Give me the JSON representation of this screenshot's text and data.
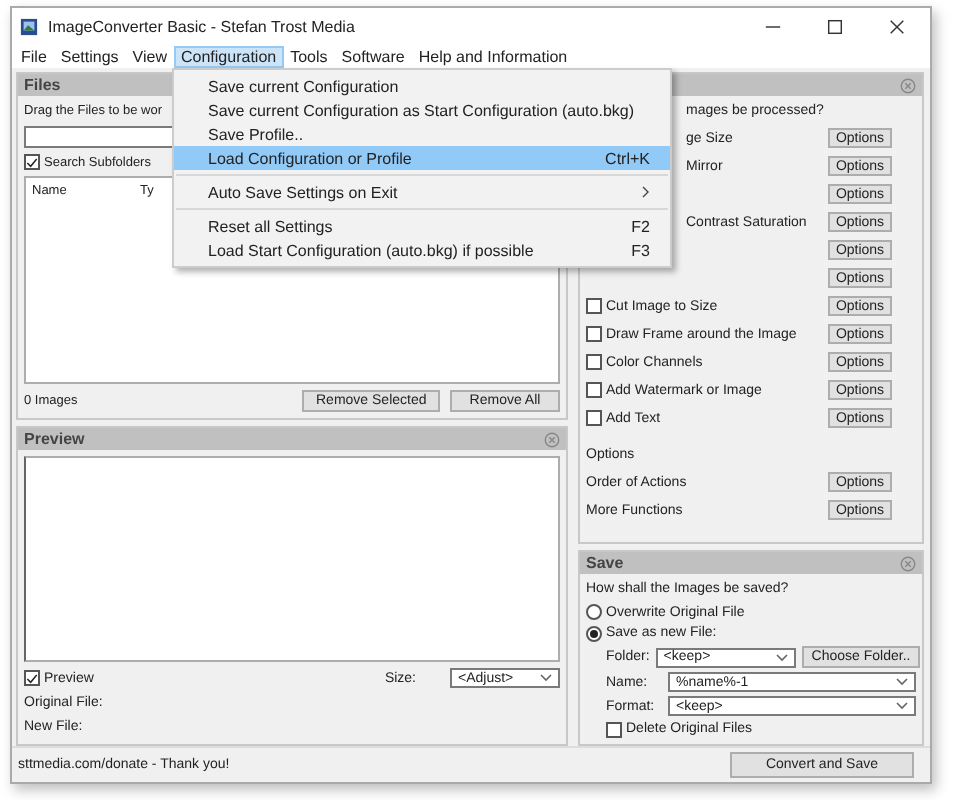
{
  "window": {
    "title": "ImageConverter Basic - Stefan Trost Media"
  },
  "menu_bar": [
    {
      "label": "File",
      "selected": false
    },
    {
      "label": "Settings",
      "selected": false
    },
    {
      "label": "View",
      "selected": false
    },
    {
      "label": "Configuration",
      "selected": true
    },
    {
      "label": "Tools",
      "selected": false
    },
    {
      "label": "Software",
      "selected": false
    },
    {
      "label": "Help and Information",
      "selected": false
    }
  ],
  "open_menu": {
    "items": [
      {
        "kind": "item",
        "label": "Save current Configuration",
        "selected": false
      },
      {
        "kind": "item",
        "label": "Save current Configuration as Start Configuration (auto.bkg)",
        "selected": false
      },
      {
        "kind": "item",
        "label": "Save Profile..",
        "selected": false
      },
      {
        "kind": "item",
        "label": "Load Configuration or Profile",
        "shortcut": "Ctrl+K",
        "selected": true
      },
      {
        "kind": "separator"
      },
      {
        "kind": "submenu",
        "label": "Auto Save Settings on Exit",
        "selected": false
      },
      {
        "kind": "separator"
      },
      {
        "kind": "item",
        "label": "Reset all Settings",
        "shortcut": "F2",
        "selected": false
      },
      {
        "kind": "item",
        "label": "Load Start Configuration (auto.bkg) if possible",
        "shortcut": "F3",
        "selected": false
      }
    ]
  },
  "files_panel": {
    "title": "Files",
    "hint": "Drag the Files to be wor",
    "search_subfolders": {
      "label": "Search Subfolders",
      "checked": true
    },
    "columns": [
      "Name",
      "Ty"
    ],
    "count": "0 Images",
    "buttons": [
      "Remove Selected",
      "Remove All"
    ]
  },
  "preview_panel": {
    "title": "Preview",
    "preview_checkbox": {
      "label": "Preview",
      "checked": true
    },
    "size_label": "Size:",
    "size_value": "<Adjust>",
    "original_file": "Original File:",
    "new_file": "New File:"
  },
  "actions_panel": {
    "question": "mages be processed?",
    "actions": [
      {
        "kind": "partial",
        "label": "ge Size",
        "button": "Options"
      },
      {
        "kind": "partial",
        "label": "Mirror",
        "button": "Options"
      },
      {
        "kind": "partial",
        "button": "Options"
      },
      {
        "kind": "partial",
        "label": "Contrast Saturation",
        "button": "Options"
      },
      {
        "kind": "partial",
        "button": "Options"
      },
      {
        "kind": "partial",
        "button": "Options"
      },
      {
        "kind": "checkbox",
        "label": "Cut Image to Size",
        "checked": false,
        "button": "Options"
      },
      {
        "kind": "checkbox",
        "label": "Draw Frame around the Image",
        "checked": false,
        "button": "Options"
      },
      {
        "kind": "checkbox",
        "label": "Color Channels",
        "checked": false,
        "button": "Options"
      },
      {
        "kind": "checkbox",
        "label": "Add Watermark or Image",
        "checked": false,
        "button": "Options"
      },
      {
        "kind": "checkbox",
        "label": "Add Text",
        "checked": false,
        "button": "Options"
      }
    ],
    "options_heading": "Options",
    "extras": [
      {
        "label": "Order of Actions",
        "button": "Options"
      },
      {
        "label": "More Functions",
        "button": "Options"
      }
    ]
  },
  "save_panel": {
    "title": "Save",
    "question": "How shall the Images be saved?",
    "modes": [
      {
        "label": "Overwrite Original File",
        "selected": false
      },
      {
        "label": "Save as new File:",
        "selected": true
      }
    ],
    "folder": {
      "label": "Folder:",
      "value": "<keep>",
      "button": "Choose Folder.."
    },
    "name": {
      "label": "Name:",
      "value": "%name%-1"
    },
    "format": {
      "label": "Format:",
      "value": "<keep>"
    },
    "delete_originals": {
      "label": "Delete Original Files",
      "checked": false
    }
  },
  "status_bar": {
    "text": "sttmedia.com/donate - Thank you!",
    "button": "Convert and Save"
  }
}
